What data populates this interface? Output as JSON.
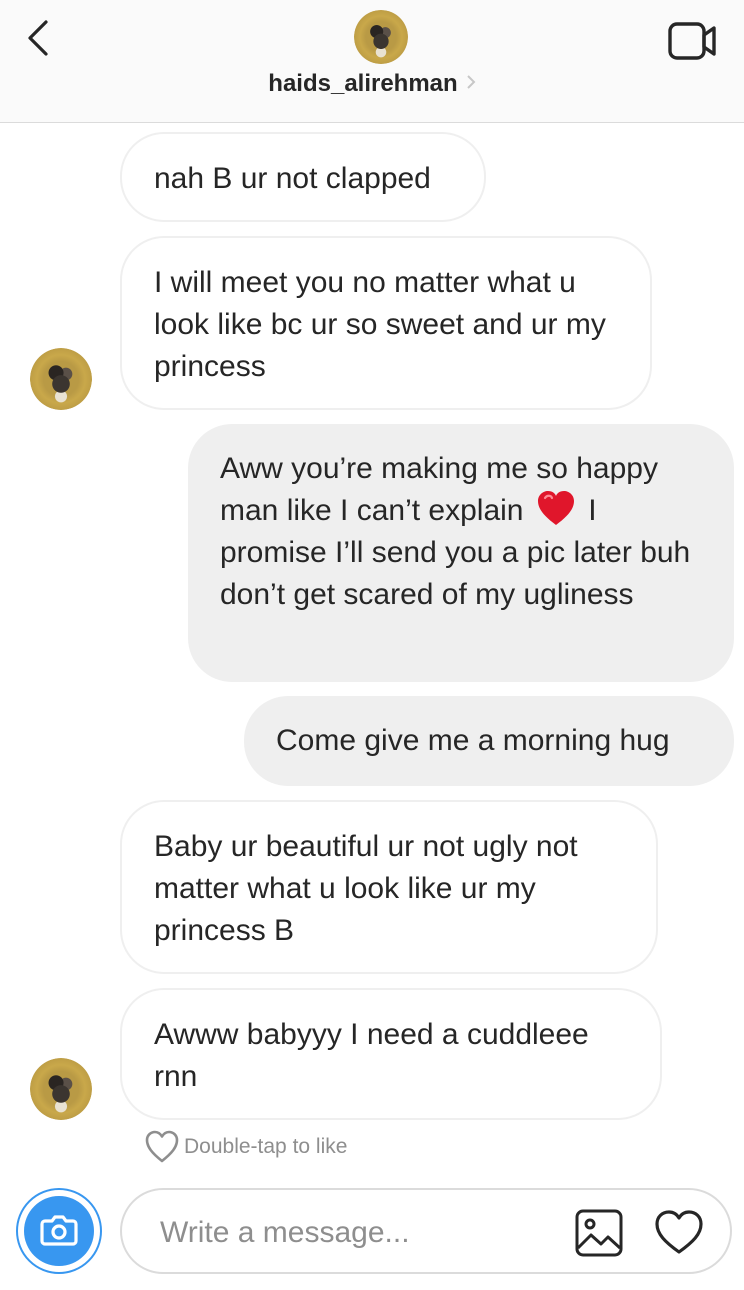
{
  "header": {
    "username": "haids_alirehman",
    "back_icon": "chevron-left-icon",
    "video_icon": "video-camera-icon"
  },
  "messages": [
    {
      "direction": "incoming",
      "text": "nah B ur not clapped"
    },
    {
      "direction": "incoming",
      "text": "I will meet you no matter what u look like bc ur so sweet and ur my princess"
    },
    {
      "direction": "outgoing",
      "text_before": "Aww you’re making me so happy man like I can’t explain",
      "emoji": "red-heart",
      "text_after": "I promise I’ll send you a pic later buh don’t get scared of my ugliness"
    },
    {
      "direction": "outgoing",
      "text": "Come give me a morning hug"
    },
    {
      "direction": "incoming",
      "text": "Baby ur beautiful ur not ugly not matter what u look like ur my princess B"
    },
    {
      "direction": "incoming",
      "text": "Awww babyyy I need a cuddleee rnn"
    }
  ],
  "like_hint": "Double-tap to like",
  "composer": {
    "placeholder": "Write a message...",
    "camera_icon": "camera-icon",
    "gallery_icon": "image-gallery-icon",
    "like_icon": "heart-outline-icon"
  },
  "colors": {
    "accent": "#3897f0",
    "incoming_border": "#efefef",
    "outgoing_bg": "#efefef",
    "text": "#262626",
    "muted": "#8e8e8e",
    "heart": "#e0162b"
  }
}
